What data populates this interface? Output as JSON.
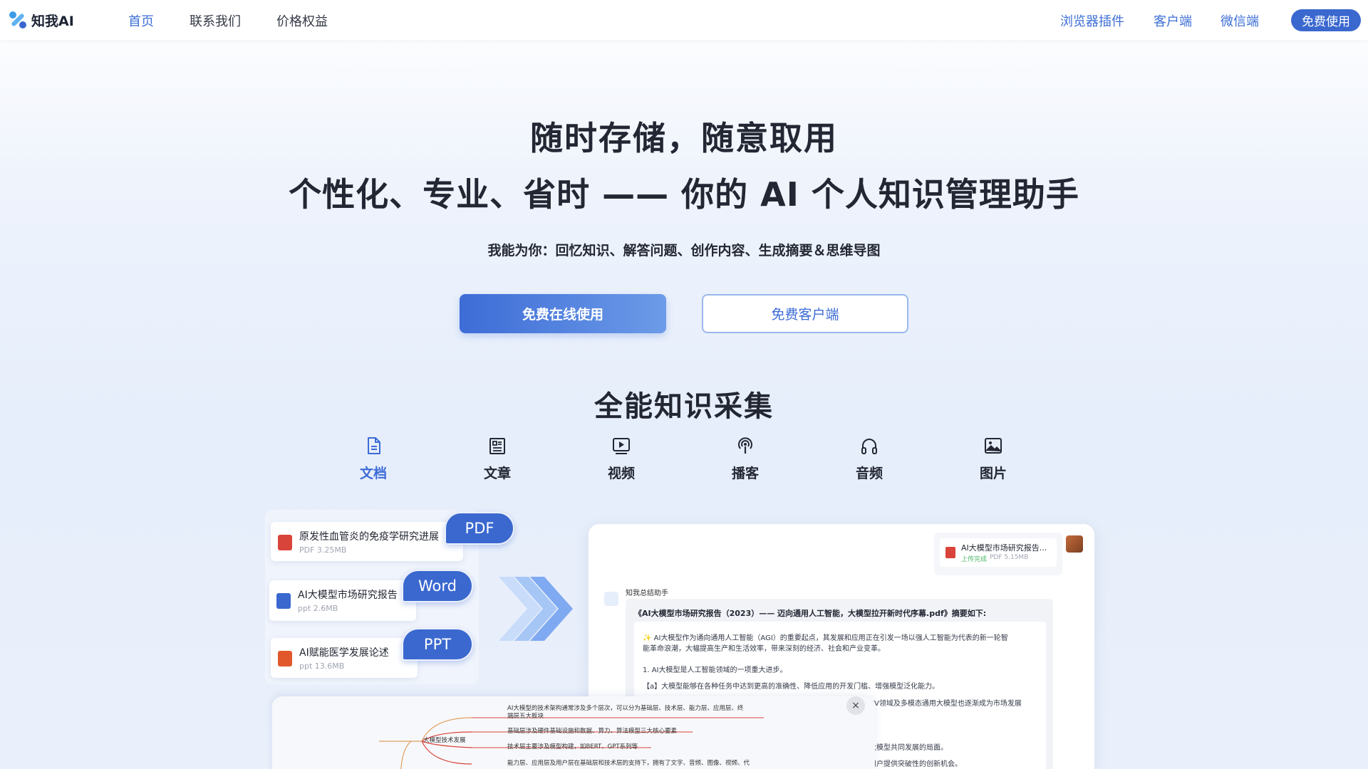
{
  "nav": {
    "logo_text": "知我AI",
    "links": [
      "首页",
      "联系我们",
      "价格权益"
    ],
    "right_links": [
      "浏览器插件",
      "客户端",
      "微信端"
    ],
    "cta": "免费使用"
  },
  "hero": {
    "title1": "随时存储，随意取用",
    "title2": "个性化、专业、省时 —— 你的 AI 个人知识管理助手",
    "subtitle": "我能为你：回忆知识、解答问题、创作内容、生成摘要＆思维导图",
    "btn_primary": "免费在线使用",
    "btn_secondary": "免费客户端"
  },
  "section": {
    "title": "全能知识采集",
    "categories": [
      {
        "label": "文档",
        "icon": "document-icon",
        "active": true
      },
      {
        "label": "文章",
        "icon": "article-icon",
        "active": false
      },
      {
        "label": "视频",
        "icon": "video-icon",
        "active": false
      },
      {
        "label": "播客",
        "icon": "podcast-icon",
        "active": false
      },
      {
        "label": "音频",
        "icon": "headphones-icon",
        "active": false
      },
      {
        "label": "图片",
        "icon": "image-icon",
        "active": false
      }
    ]
  },
  "files": [
    {
      "name": "原发性血管炎的免疫学研究进展",
      "meta": "PDF 3.25MB",
      "type": "PDF",
      "color": "#d9443a"
    },
    {
      "name": "AI大模型市场研究报告",
      "meta": "ppt 2.6MB",
      "type": "Word",
      "color": "#3a68cf"
    },
    {
      "name": "AI赋能医学发展论述",
      "meta": "ppt 13.6MB",
      "type": "PPT",
      "color": "#e0582c"
    }
  ],
  "chat": {
    "upload_name": "AI大模型市场研究报告...",
    "upload_status": "上传完成",
    "upload_meta": "PDF 5.15MB",
    "assistant_name": "知我总结助手",
    "summary_title": "《AI大模型市场研究报告（2023）—— 迈向通用人工智能，大模型拉开新时代序幕.pdf》摘要如下:",
    "lines": [
      "✨ AI大模型作为通向通用人工智能（AGI）的重要起点，其发展和应用正在引发一场以强人工智能为代表的新一轮智",
      "能革命浪潮，大幅提高生产和生活效率，带来深刻的经济、社会和产业变革。",
      "1. AI大模型是人工智能领域的一项重大进步。",
      "【a】大模型能够在各种任务中达到更高的准确性、降低应用的开发门槛、增强模型泛化能力。",
      "CV领域及多模态通用大模型也逐渐成为市场发展",
      "大模型共同发展的局面。",
      "用户提供突破性的创新机会。"
    ]
  },
  "mindmap": {
    "root": "大模型技术发展",
    "close": "×",
    "branches": [
      "AI大模型的技术架构通常涉及多个层次，可以分为基础层、技术层、能力层、应用层、终",
      "端层五大板块",
      "基础层涉及硬件基础设施和数据、算力、算法模型三大核心要素",
      "技术层主要涉及模型构建，如BERT、GPT系列等",
      "能力层、应用层及用户层在基础层和技术层的支持下，拥有了文字、音频、图像、视频、代"
    ]
  }
}
